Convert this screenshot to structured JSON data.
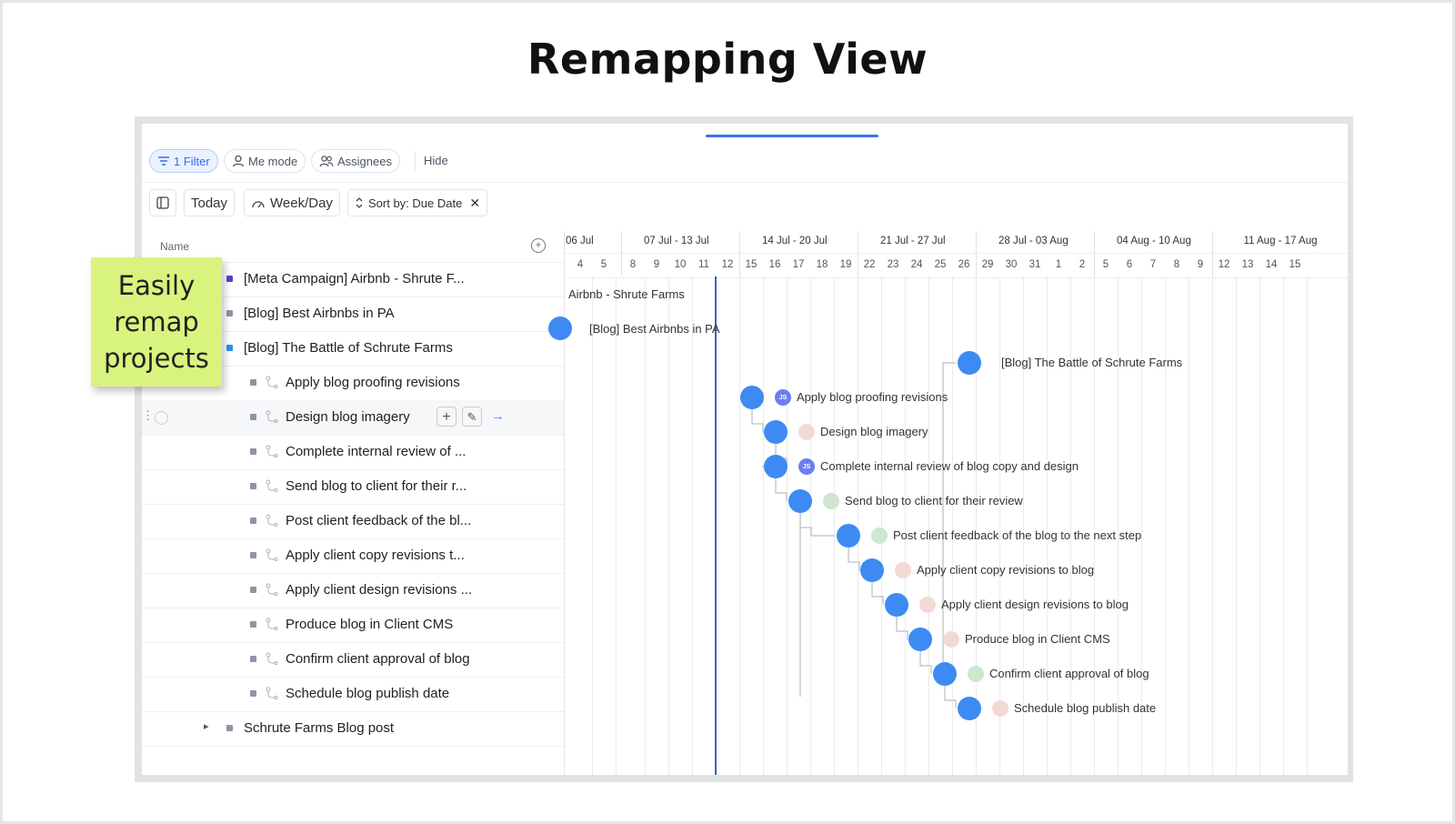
{
  "slide_title": "Remapping View",
  "sticky_note": {
    "line1": "Easily",
    "line2": "remap",
    "line3": "projects"
  },
  "toolbar1": {
    "filter": "1 Filter",
    "me_mode": "Me mode",
    "assignees": "Assignees",
    "hide": "Hide"
  },
  "toolbar2": {
    "today": "Today",
    "week_day": "Week/Day",
    "sort": "Sort by: Due Date"
  },
  "name_header": "Name",
  "weeks": [
    "06 Jul",
    "07 Jul - 13 Jul",
    "14 Jul - 20 Jul",
    "21 Jul - 27 Jul",
    "28 Jul - 03 Aug",
    "04 Aug - 10 Aug",
    "11 Aug - 17 Aug"
  ],
  "days": [
    "4",
    "5",
    "8",
    "9",
    "10",
    "11",
    "12",
    "15",
    "16",
    "17",
    "18",
    "19",
    "22",
    "23",
    "24",
    "25",
    "26",
    "29",
    "30",
    "31",
    "1",
    "2",
    "5",
    "6",
    "7",
    "8",
    "9",
    "12",
    "13",
    "14",
    "15"
  ],
  "rows": [
    {
      "label": "[Meta Campaign] Airbnb - Shrute F...",
      "color": "#5a3fd6"
    },
    {
      "label": "[Blog] Best Airbnbs in PA",
      "color": "#8b96a5"
    },
    {
      "label": "[Blog] The Battle of Schrute Farms",
      "color": "#2f8fe6"
    },
    {
      "label": "Apply blog proofing revisions"
    },
    {
      "label": "Design blog imagery"
    },
    {
      "label": "Complete internal review of ..."
    },
    {
      "label": "Send blog to client for their r..."
    },
    {
      "label": "Post client feedback of the bl..."
    },
    {
      "label": "Apply client copy revisions t..."
    },
    {
      "label": "Apply client design revisions ..."
    },
    {
      "label": "Produce blog in Client CMS"
    },
    {
      "label": "Confirm client approval of blog"
    },
    {
      "label": "Schedule blog publish date"
    },
    {
      "label": "Schrute Farms Blog post"
    }
  ],
  "timeline_labels": [
    "Airbnb - Shrute Farms",
    "[Blog] Best Airbnbs in PA",
    "[Blog] The Battle of Schrute Farms",
    "Apply blog proofing revisions",
    "Design blog imagery",
    "Complete internal review of blog copy and design",
    "Send blog to client for their review",
    "Post client feedback of the blog to the next step",
    "Apply client copy revisions to blog",
    "Apply client design revisions to blog",
    "Produce blog in Client CMS",
    "Confirm client approval of blog",
    "Schedule blog publish date"
  ],
  "avatar_initials": "JS",
  "colors": {
    "accent": "#3b73e6",
    "dot": "#3d8bf2",
    "sticky": "#d9f47e",
    "today_line": "#3b5bd8"
  }
}
